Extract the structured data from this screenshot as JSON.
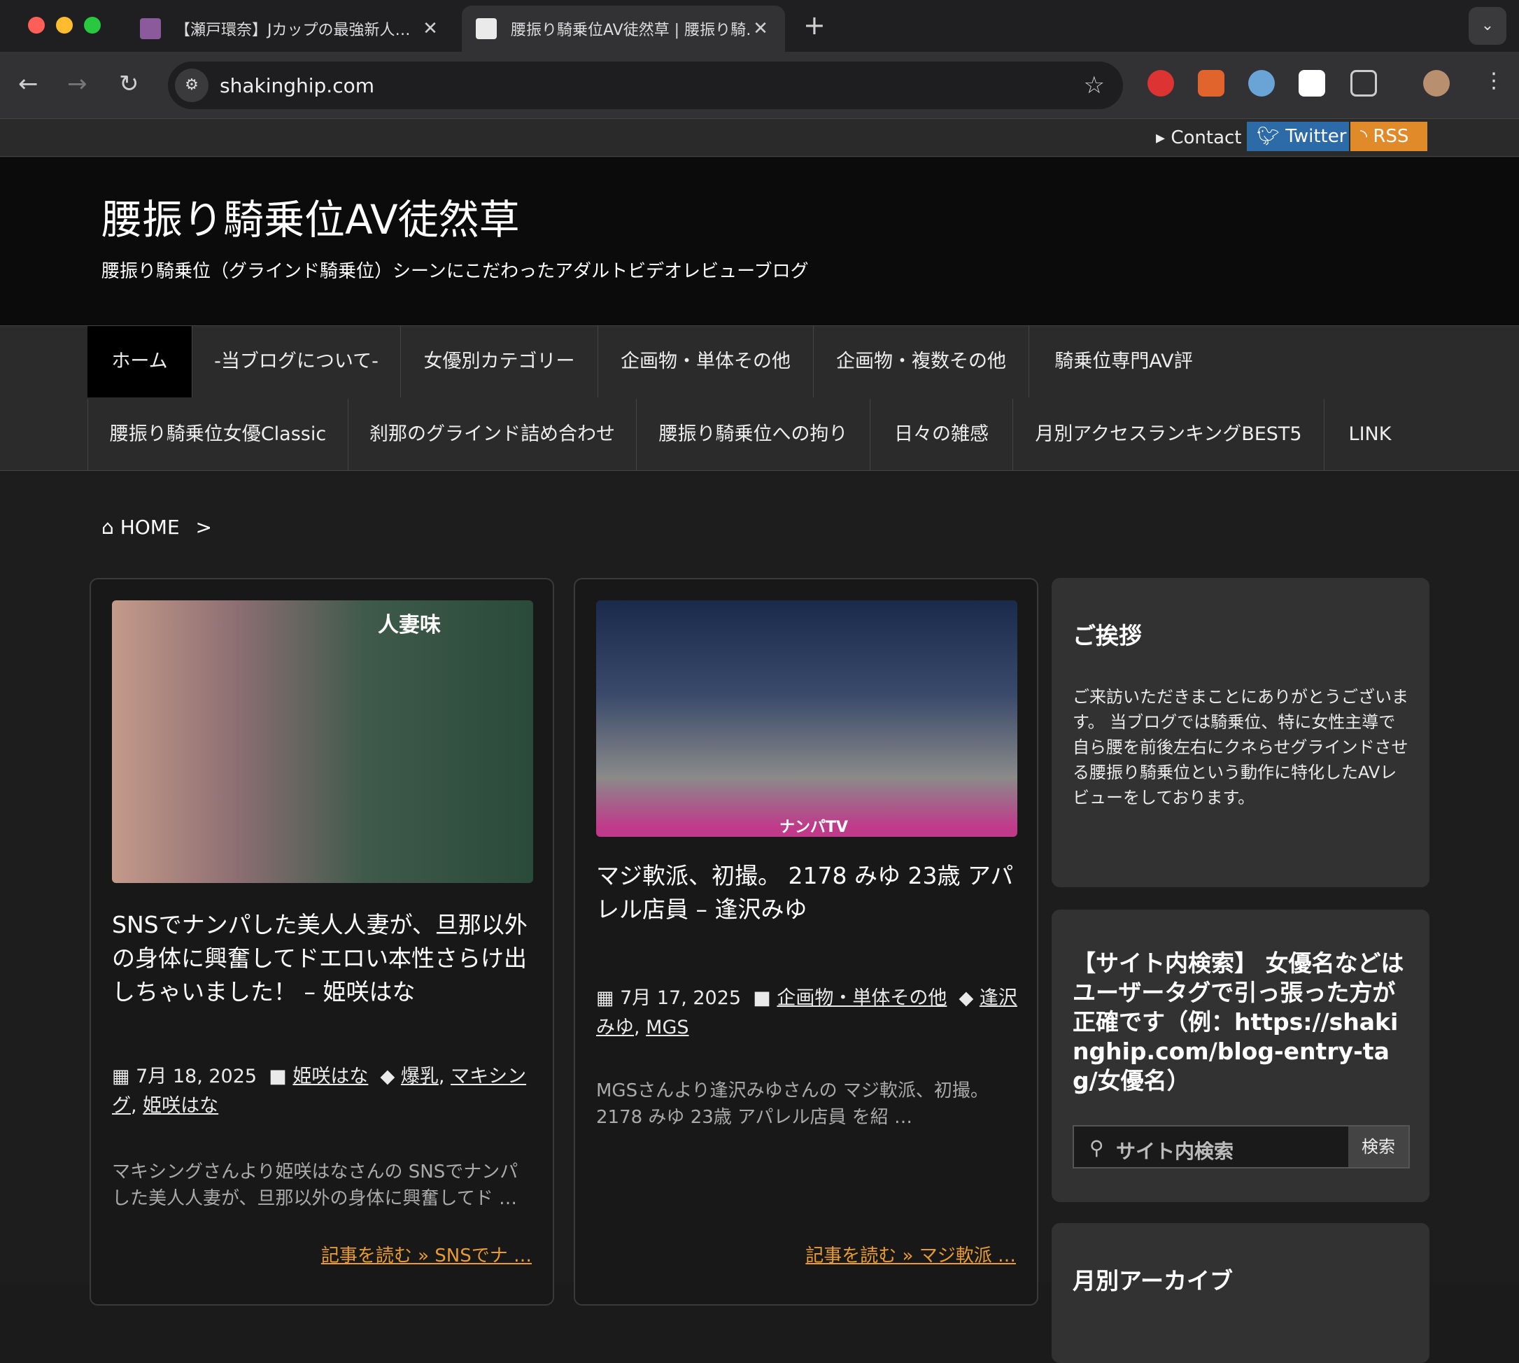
{
  "browser": {
    "tabs": [
      {
        "title": "【瀬戸環奈】Jカップの最強新人…"
      },
      {
        "title": "腰振り騎乗位AV徒然草 | 腰振り騎…"
      }
    ],
    "new_tab": "+",
    "url": "shakinghip.com"
  },
  "site": {
    "topbar": {
      "contact": "Contact",
      "twitter": "Twitter",
      "rss": "RSS"
    },
    "title": "腰振り騎乗位AV徒然草",
    "description": "腰振り騎乗位（グラインド騎乗位）シーンにこだわったアダルトビデオレビューブログ",
    "nav_row1": [
      "ホーム",
      "-当ブログについて-",
      "女優別カテゴリー",
      "企画物・単体その他",
      "企画物・複数その他",
      "騎乗位専門AV評"
    ],
    "nav_row2": [
      "腰振り騎乗位女優Classic",
      "刹那のグラインド詰め合わせ",
      "腰振り騎乗位への拘り",
      "日々の雑感",
      "月別アクセスランキングBEST5",
      "LINK"
    ],
    "breadcrumb": {
      "home": "HOME",
      "sep": ">"
    }
  },
  "posts": [
    {
      "title": "SNSでナンパした美人人妻が、旦那以外の身体に興奮してドエロい本性さらけ出しちゃいました！ – 姫咲はな",
      "date": "7月 18, 2025",
      "category": "姫咲はな",
      "tags": [
        "爆乳",
        "マキシング",
        "姫咲はな"
      ],
      "excerpt": "マキシングさんより姫咲はなさんの SNSでナンパした美人人妻が、旦那以外の身体に興奮してド …",
      "readmore": "記事を読む »  SNSでナ …",
      "thumb_text": "人妻味"
    },
    {
      "title": "マジ軟派、初撮。 2178 みゆ 23歳 アパレル店員 – 逢沢みゆ",
      "date": "7月 17, 2025",
      "category": "企画物・単体その他",
      "tags": [
        "逢沢みゆ",
        "MGS"
      ],
      "excerpt": "MGSさんより逢沢みゆさんの マジ軟派、初撮。 2178 みゆ 23歳 アパレル店員 を紹 …",
      "readmore": "記事を読む »  マジ軟派 …",
      "thumb_text": "ナンパTV"
    }
  ],
  "sidebar": {
    "greeting_title": "ご挨拶",
    "greeting_text": "ご来訪いただきまことにありがとうございます。 当ブログでは騎乗位、特に女性主導で自ら腰を前後左右にクネらせグラインドさせる腰振り騎乗位という動作に特化したAVレビューをしております。",
    "search_title": "【サイト内検索】 女優名などはユーザータグで引っ張った方が正確です（例：https://shakinghip.com/blog-entry-tag/女優名）",
    "search_placeholder": "サイト内検索",
    "search_button": "検索",
    "archive_title": "月別アーカイブ"
  }
}
